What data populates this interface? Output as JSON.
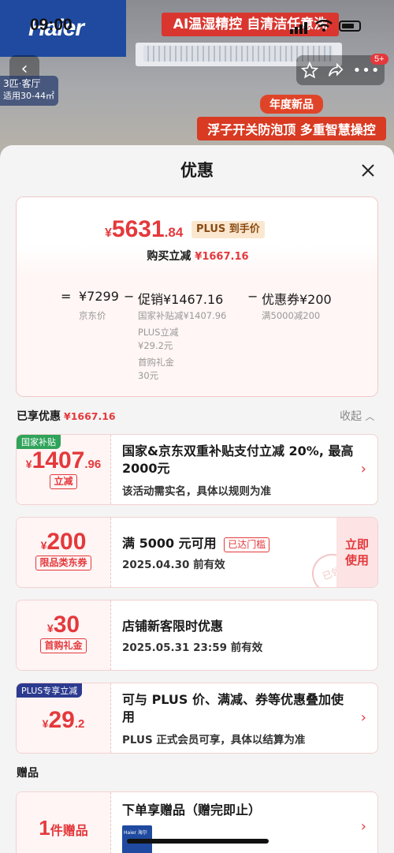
{
  "status_bar": {
    "time": "09:00"
  },
  "product": {
    "brand_logo": "Haier",
    "banner": "AI温湿精控 自清洁任意洗",
    "room_tag_line1": "3匹·客厅",
    "room_tag_line2": "适用30-44㎡",
    "year_badge": "年度新品",
    "feature_line": "浮子开关防泡顶 多重智慧操控",
    "cart_count": "5+"
  },
  "sheet": {
    "title": "优惠"
  },
  "summary": {
    "currency": "¥",
    "price_int": "5631",
    "price_dec": ".84",
    "plus_label": "PLUS 到手价",
    "instant_label": "购买立减",
    "instant_amount": "¥1667.16",
    "formula": {
      "eq": "=",
      "jd_price": "¥7299",
      "jd_price_label": "京东价",
      "minus1": "−",
      "promo": "促销¥1467.16",
      "promo_items": [
        "国家补贴减¥1407.96",
        "PLUS立减",
        "¥29.2元",
        "首购礼金",
        "30元"
      ],
      "minus2": "−",
      "coupon": "优惠券¥200",
      "coupon_sub": "满5000减200"
    }
  },
  "enjoyed": {
    "title": "已享优惠",
    "amount": "¥1667.16",
    "collapse": "收起"
  },
  "cards": [
    {
      "corner": "国家补贴",
      "cur": "¥",
      "int": "1407",
      "dec": ".96",
      "chip": "立减",
      "title": "国家&京东双重补贴支付立减 20%, 最高 2000元",
      "desc": "该活动需实名，具体以规则为准"
    },
    {
      "cur": "¥",
      "int": "200",
      "dec": "",
      "chip": "限品类东券",
      "title": "满 5000 元可用",
      "title_tag": "已达门槛",
      "desc": "2025.04.30 前有效",
      "action": "立即使用",
      "stamp": "已领"
    },
    {
      "cur": "¥",
      "int": "30",
      "dec": "",
      "chip": "首购礼金",
      "title": "店铺新客限时优惠",
      "desc": "2025.05.31 23:59 前有效"
    },
    {
      "corner": "PLUS专享立减",
      "cur": "¥",
      "int": "29",
      "dec": ".2",
      "title": "可与 PLUS 价、满减、券等优惠叠加使用",
      "desc": "PLUS 正式会员可享，具体以结算为准"
    }
  ],
  "gifts": {
    "title": "赠品",
    "count": "1",
    "count_unit": "件赠品",
    "card_title": "下单享赠品（赠完即止）",
    "thumb_text": "Haier 海尔"
  },
  "colors": {
    "accent": "#e4393c",
    "plus_gold": "#8a4b12",
    "plus_navy": "#2b3b8f",
    "gov_green": "#2fa35a"
  }
}
